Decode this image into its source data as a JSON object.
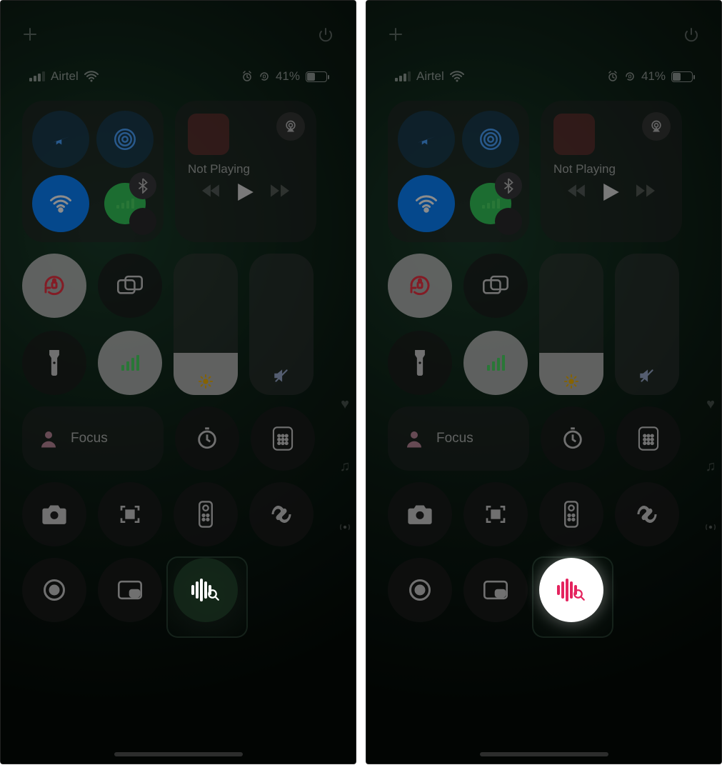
{
  "statusbar": {
    "carrier": "Airtel",
    "battery_pct": "41%"
  },
  "nowplaying": {
    "title": "Not Playing"
  },
  "focus": {
    "label": "Focus"
  },
  "left_panel": {
    "music_recognition_state": "off"
  },
  "right_panel": {
    "music_recognition_state": "on"
  }
}
